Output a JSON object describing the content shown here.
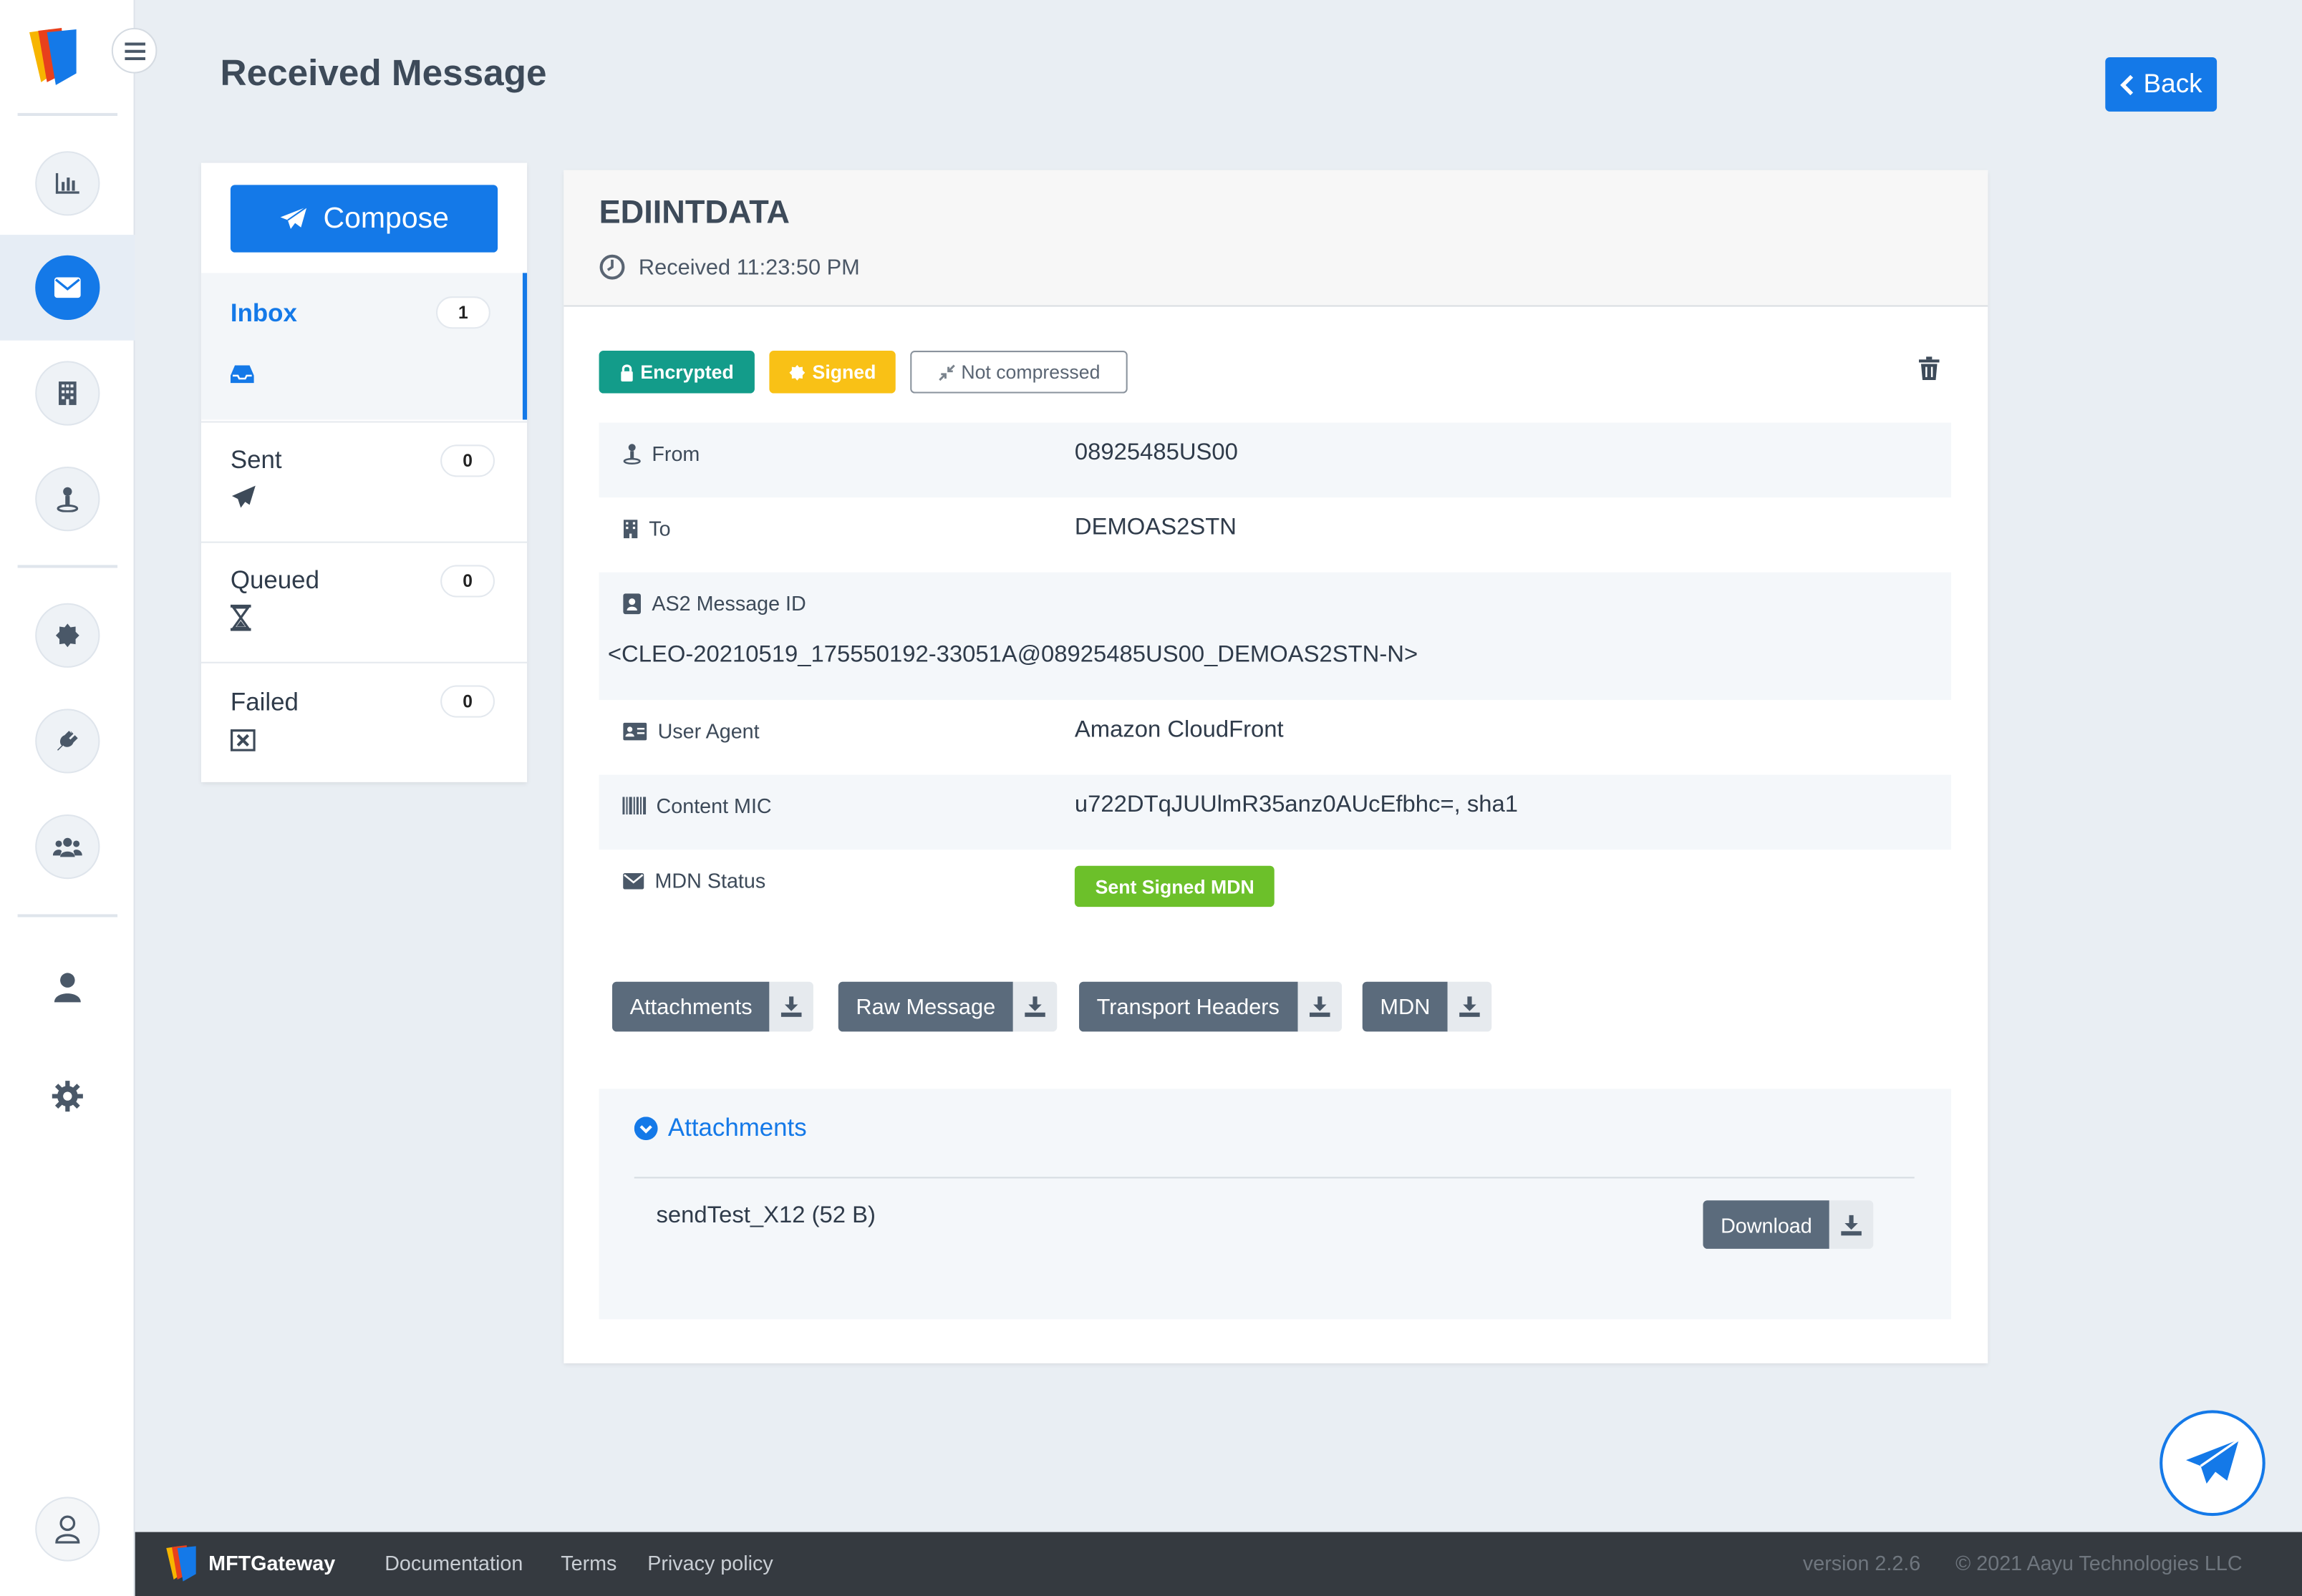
{
  "page": {
    "title": "Received Message",
    "back_label": "Back"
  },
  "folders": {
    "compose_label": "Compose",
    "items": [
      {
        "label": "Inbox",
        "count": "1"
      },
      {
        "label": "Sent",
        "count": "0"
      },
      {
        "label": "Queued",
        "count": "0"
      },
      {
        "label": "Failed",
        "count": "0"
      }
    ]
  },
  "message": {
    "subject": "EDIINTDATA",
    "received": "Received 11:23:50 PM",
    "badges": {
      "encrypted": "Encrypted",
      "signed": "Signed",
      "compression": "Not compressed"
    },
    "fields": {
      "from_label": "From",
      "from_value": "08925485US00",
      "to_label": "To",
      "to_value": "DEMOAS2STN",
      "msgid_label": "AS2 Message ID",
      "msgid_value": "<CLEO-20210519_175550192-33051A@08925485US00_DEMOAS2STN-N>",
      "ua_label": "User Agent",
      "ua_value": "Amazon CloudFront",
      "mic_label": "Content MIC",
      "mic_value": "u722DTqJUUlmR35anz0AUcEfbhc=, sha1",
      "mdn_label": "MDN Status",
      "mdn_value": "Sent Signed MDN"
    },
    "downloads": [
      "Attachments",
      "Raw Message",
      "Transport Headers",
      "MDN"
    ],
    "attachments": {
      "title": "Attachments",
      "file": "sendTest_X12 (52 B)",
      "download_label": "Download"
    }
  },
  "footer": {
    "brand": "MFTGateway",
    "links": [
      "Documentation",
      "Terms",
      "Privacy policy"
    ],
    "version": "version 2.2.6",
    "copyright": "© 2021 Aayu Technologies LLC"
  },
  "colors": {
    "accent": "#1479e8",
    "encrypted": "#139c8a",
    "signed": "#f9c116",
    "mdn_ok": "#6cc02a",
    "button_dark": "#5b6b7c"
  }
}
